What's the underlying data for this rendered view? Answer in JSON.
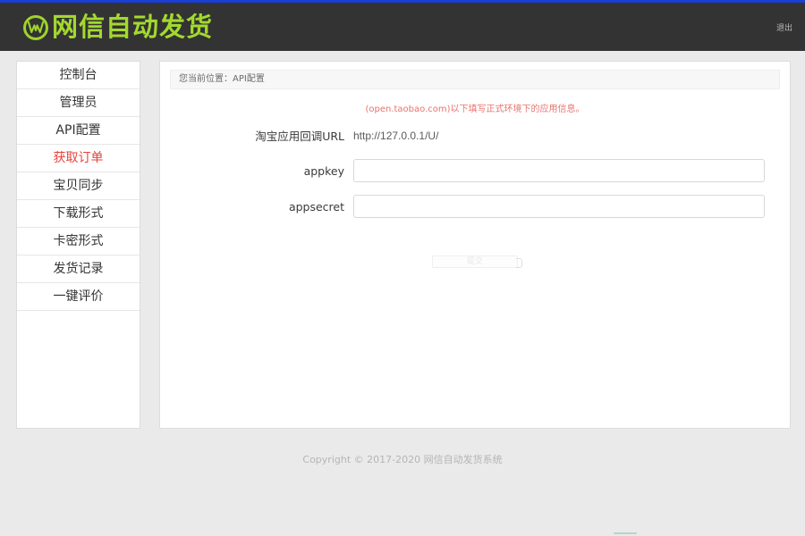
{
  "colors": {
    "top_strip": "#1a3fd4",
    "header_bg": "#333333",
    "brand_green": "#a3d92e",
    "page_bg": "#eaeaea",
    "panel_bg": "#ffffff",
    "active_menu": "#e8413a",
    "notice_red": "#e8746e",
    "footer_text": "#b5b5b5"
  },
  "header": {
    "brand_name": "网信自动发货",
    "logo_icon": "circle-w-logo-icon",
    "logout_label": "退出"
  },
  "sidebar": {
    "items": [
      {
        "label": "控制台",
        "name": "sidebar-item-dashboard",
        "active": false
      },
      {
        "label": "管理员",
        "name": "sidebar-item-admin",
        "active": false
      },
      {
        "label": "API配置",
        "name": "sidebar-item-api-config",
        "active": false
      },
      {
        "label": "获取订单",
        "name": "sidebar-item-get-orders",
        "active": true
      },
      {
        "label": "宝贝同步",
        "name": "sidebar-item-item-sync",
        "active": false
      },
      {
        "label": "下载形式",
        "name": "sidebar-item-download-mode",
        "active": false
      },
      {
        "label": "卡密形式",
        "name": "sidebar-item-card-key-mode",
        "active": false
      },
      {
        "label": "发货记录",
        "name": "sidebar-item-shipping-records",
        "active": false
      },
      {
        "label": "一键评价",
        "name": "sidebar-item-one-click-review",
        "active": false
      }
    ]
  },
  "main": {
    "breadcrumb": "您当前位置：API配置",
    "notice": "(open.taobao.com)以下填写正式环境下的应用信息。",
    "form": {
      "callback_url_label": "淘宝应用回调URL",
      "callback_url_value": "http://127.0.0.1/U/",
      "appkey_label": "appkey",
      "appkey_value": "",
      "appkey_placeholder": "",
      "appsecret_label": "appsecret",
      "appsecret_value": "",
      "appsecret_placeholder": "",
      "submit_label": "提交"
    }
  },
  "footer": {
    "copyright": "Copyright © 2017-2020 网信自动发货系统"
  }
}
